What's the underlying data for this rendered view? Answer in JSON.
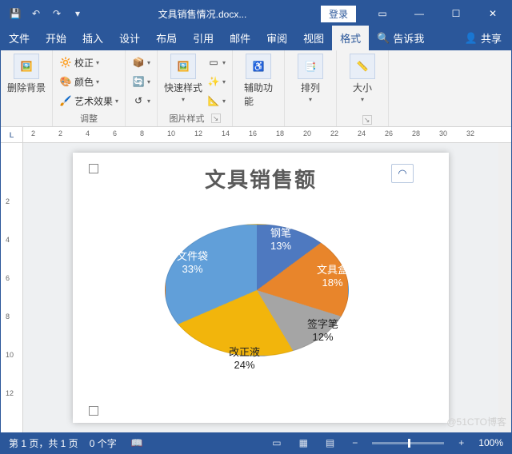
{
  "titlebar": {
    "document_name": "文具销售情况.docx...",
    "login": "登录"
  },
  "tabs": {
    "items": [
      "文件",
      "开始",
      "插入",
      "设计",
      "布局",
      "引用",
      "邮件",
      "审阅",
      "视图",
      "格式"
    ],
    "active_index": 9,
    "tell_me": "告诉我",
    "share": "共享"
  },
  "ribbon": {
    "remove_bg": "删除背景",
    "adjust": {
      "label": "调整",
      "correction": "校正",
      "color": "颜色",
      "artistic": "艺术效果"
    },
    "pic_styles": {
      "label": "图片样式",
      "quick_styles": "快速样式"
    },
    "accessibility": "辅助功\n能",
    "arrange": "排列",
    "size": "大小"
  },
  "ruler": {
    "corner": "L",
    "marks": [
      "2",
      "2",
      "4",
      "6",
      "8",
      "10",
      "12",
      "14",
      "16",
      "18",
      "20",
      "22",
      "24",
      "26",
      "28",
      "30",
      "32"
    ]
  },
  "vruler": [
    "",
    "2",
    "4",
    "6",
    "8",
    "10",
    "12"
  ],
  "chart_title": "文具销售额",
  "status": {
    "page": "第 1 页，共 1 页",
    "words": "0 个字",
    "zoom": "100%"
  },
  "watermark": "@51CTO博客",
  "chart_data": {
    "type": "pie",
    "title": "文具销售额",
    "categories": [
      "钢笔",
      "文具盒",
      "签字笔",
      "改正液",
      "文件袋"
    ],
    "values": [
      13,
      18,
      12,
      24,
      33
    ],
    "percent_labels": [
      "13%",
      "18%",
      "12%",
      "24%",
      "33%"
    ],
    "colors": [
      "#4e79c0",
      "#e8852b",
      "#a5a5a5",
      "#f2b50c",
      "#619fd9"
    ]
  }
}
